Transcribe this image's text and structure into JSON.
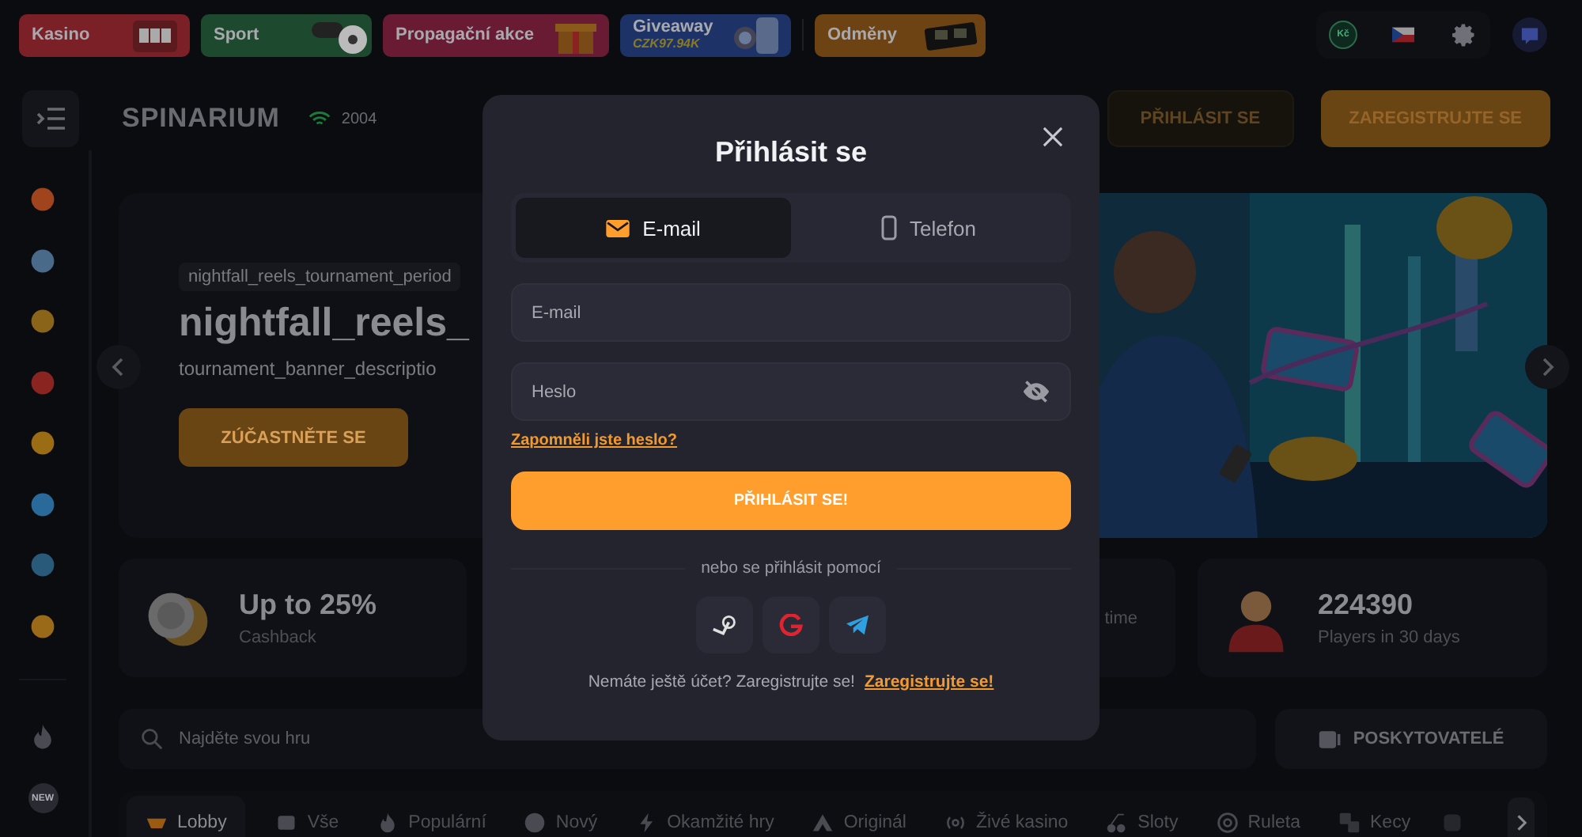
{
  "promo_tabs": [
    {
      "label": "Kasino",
      "color": "#7a2026",
      "kind": "slot"
    },
    {
      "label": "Sport",
      "color": "#1d4a2e",
      "kind": "ball"
    },
    {
      "label": "Propagační akce",
      "color": "#6a1b34",
      "kind": "gift"
    },
    {
      "label": "Giveaway",
      "amount": "CZK97.94K",
      "color": "#1d3368",
      "kind": "phone"
    },
    {
      "label": "Odměny",
      "color": "#6e4313",
      "kind": "cash"
    }
  ],
  "top_right": {
    "currency": "Kč"
  },
  "header": {
    "logo": "SPINARIUM",
    "online": "2004",
    "login": "PŘIHLÁSIT SE",
    "register": "ZAREGISTRUJTE SE"
  },
  "banner": {
    "tag": "nightfall_reels_tournament_period",
    "title": "nightfall_reels_",
    "description": "tournament_banner_descriptio",
    "button": "ZÚČASTNĚTE SE"
  },
  "stats": [
    {
      "kind": "coins",
      "value": "Up to 25%",
      "label": "Cashback"
    },
    {
      "kind": "partial",
      "label": "time"
    },
    {
      "kind": "player",
      "value": "224390",
      "label": "Players in 30 days"
    }
  ],
  "search": {
    "placeholder": "Najděte svou hru"
  },
  "providers_button": "POSKYTOVATELÉ",
  "categories": [
    {
      "label": "Lobby",
      "kind": "lobby",
      "selected": true
    },
    {
      "label": "Vše",
      "kind": "all",
      "selected": false
    },
    {
      "label": "Populární",
      "kind": "popular",
      "selected": false
    },
    {
      "label": "Nový",
      "kind": "new",
      "selected": false
    },
    {
      "label": "Okamžité hry",
      "kind": "instant",
      "selected": false
    },
    {
      "label": "Originál",
      "kind": "original",
      "selected": false
    },
    {
      "label": "Živé kasino",
      "kind": "live",
      "selected": false
    },
    {
      "label": "Sloty",
      "kind": "slots",
      "selected": false
    },
    {
      "label": "Ruleta",
      "kind": "roulette",
      "selected": false
    },
    {
      "label": "Kecy",
      "kind": "dice",
      "selected": false
    }
  ],
  "sidebar_badge": "NEW",
  "modal": {
    "title": "Přihlásit se",
    "tabs": [
      {
        "label": "E-mail",
        "kind": "email",
        "selected": true
      },
      {
        "label": "Telefon",
        "kind": "phone",
        "selected": false
      }
    ],
    "fields": [
      {
        "placeholder": "E-mail",
        "kind": "email"
      },
      {
        "placeholder": "Heslo",
        "kind": "password"
      }
    ],
    "forgot": "Zapomněli jste heslo?",
    "submit": "PŘIHLÁSIT SE!",
    "divider": "nebo se přihlásit pomocí",
    "footer": "Nemáte ještě účet? Zaregistrujte se!",
    "footer_link": "Zaregistrujte se!"
  }
}
